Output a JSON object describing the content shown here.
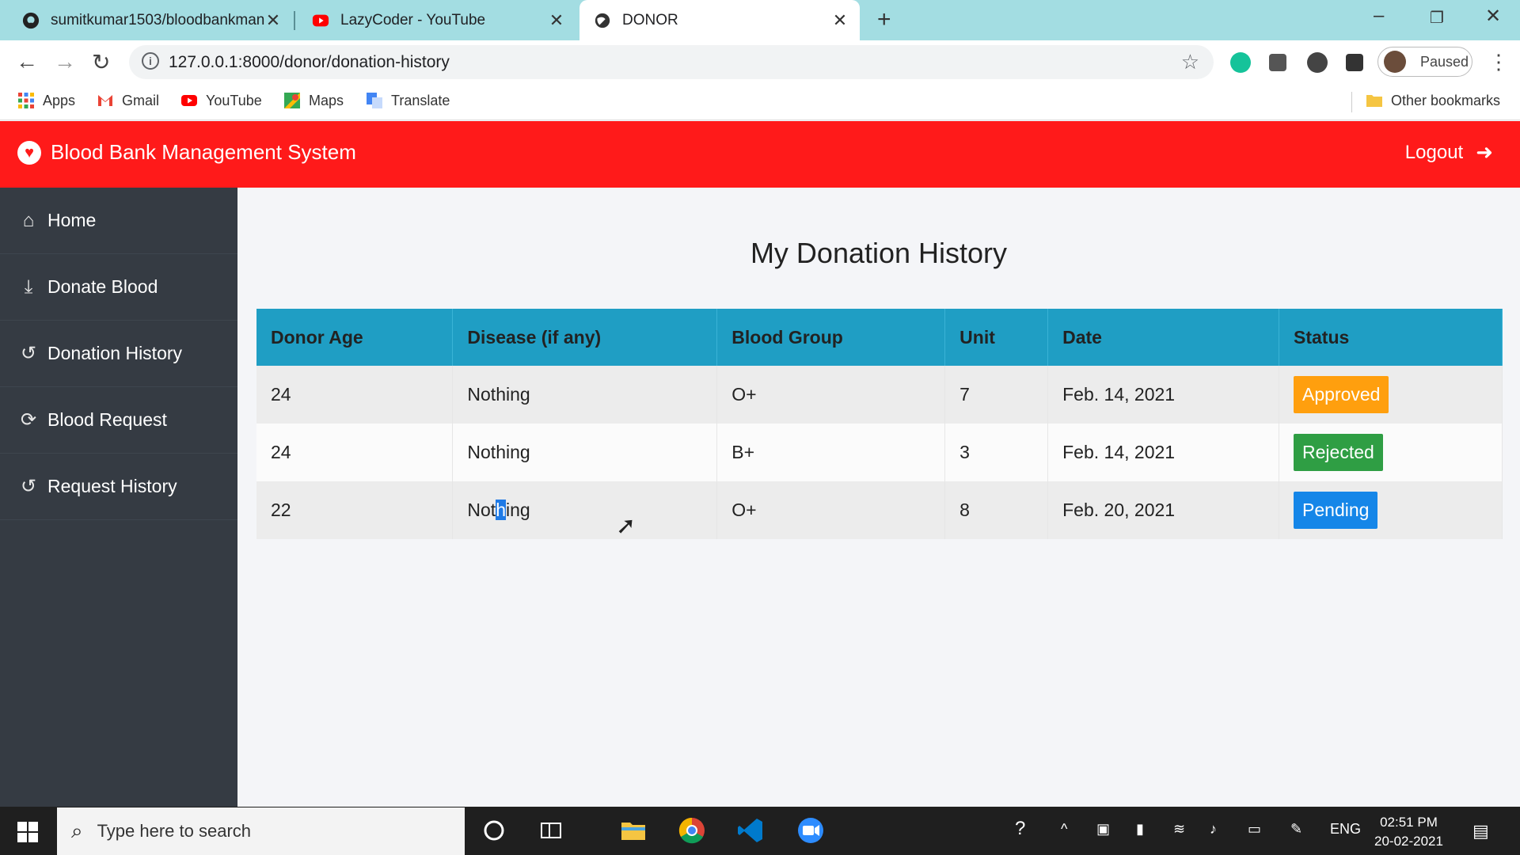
{
  "browser": {
    "tabs": [
      {
        "title": "sumitkumar1503/bloodbankman",
        "icon": "github-icon"
      },
      {
        "title": "LazyCoder - YouTube",
        "icon": "youtube-icon"
      },
      {
        "title": "DONOR",
        "icon": "globe-icon"
      }
    ],
    "url": "127.0.0.1:8000/donor/donation-history",
    "profile_label": "Paused",
    "bookmarks": [
      {
        "label": "Apps"
      },
      {
        "label": "Gmail"
      },
      {
        "label": "YouTube"
      },
      {
        "label": "Maps"
      },
      {
        "label": "Translate"
      }
    ],
    "other_bookmarks": "Other bookmarks"
  },
  "app": {
    "title": "Blood Bank Management System",
    "logout": "Logout",
    "accent": "#ff1a1a"
  },
  "sidebar": {
    "items": [
      {
        "label": "Home",
        "icon": "home-icon"
      },
      {
        "label": "Donate Blood",
        "icon": "donate-icon"
      },
      {
        "label": "Donation History",
        "icon": "history-icon"
      },
      {
        "label": "Blood Request",
        "icon": "refresh-icon"
      },
      {
        "label": "Request History",
        "icon": "history-icon"
      }
    ]
  },
  "main": {
    "title": "My Donation History",
    "columns": [
      "Donor Age",
      "Disease (if any)",
      "Blood Group",
      "Unit",
      "Date",
      "Status"
    ],
    "rows": [
      {
        "age": "24",
        "disease": "Nothing",
        "group": "O+",
        "unit": "7",
        "date": "Feb. 14, 2021",
        "status": "Approved",
        "status_color": "#ff9f0e"
      },
      {
        "age": "24",
        "disease": "Nothing",
        "group": "B+",
        "unit": "3",
        "date": "Feb. 14, 2021",
        "status": "Rejected",
        "status_color": "#2f9e44"
      },
      {
        "age": "22",
        "disease": "Nothing",
        "group": "O+",
        "unit": "8",
        "date": "Feb. 20, 2021",
        "status": "Pending",
        "status_color": "#1586e8"
      }
    ],
    "header_color": "#1f9ec4"
  },
  "taskbar": {
    "search_placeholder": "Type here to search",
    "language": "ENG",
    "time": "02:51 PM",
    "date": "20-02-2021"
  }
}
